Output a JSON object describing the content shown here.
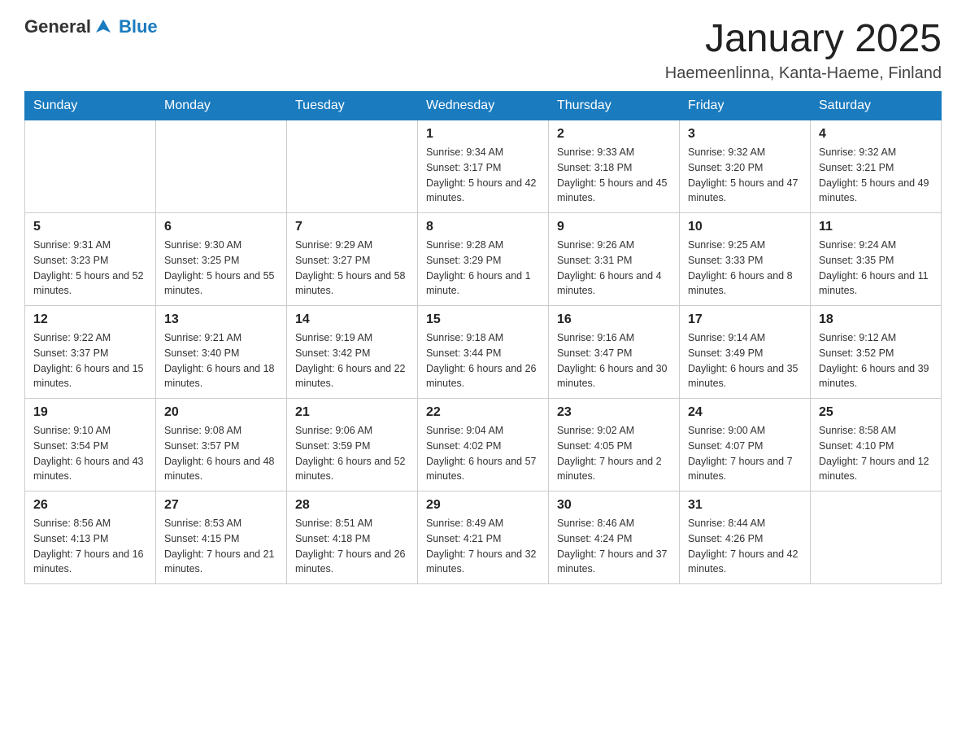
{
  "logo": {
    "text_general": "General",
    "text_blue": "Blue"
  },
  "title": "January 2025",
  "subtitle": "Haemeenlinna, Kanta-Haeme, Finland",
  "days_of_week": [
    "Sunday",
    "Monday",
    "Tuesday",
    "Wednesday",
    "Thursday",
    "Friday",
    "Saturday"
  ],
  "weeks": [
    [
      {
        "day": "",
        "info": ""
      },
      {
        "day": "",
        "info": ""
      },
      {
        "day": "",
        "info": ""
      },
      {
        "day": "1",
        "info": "Sunrise: 9:34 AM\nSunset: 3:17 PM\nDaylight: 5 hours and 42 minutes."
      },
      {
        "day": "2",
        "info": "Sunrise: 9:33 AM\nSunset: 3:18 PM\nDaylight: 5 hours and 45 minutes."
      },
      {
        "day": "3",
        "info": "Sunrise: 9:32 AM\nSunset: 3:20 PM\nDaylight: 5 hours and 47 minutes."
      },
      {
        "day": "4",
        "info": "Sunrise: 9:32 AM\nSunset: 3:21 PM\nDaylight: 5 hours and 49 minutes."
      }
    ],
    [
      {
        "day": "5",
        "info": "Sunrise: 9:31 AM\nSunset: 3:23 PM\nDaylight: 5 hours and 52 minutes."
      },
      {
        "day": "6",
        "info": "Sunrise: 9:30 AM\nSunset: 3:25 PM\nDaylight: 5 hours and 55 minutes."
      },
      {
        "day": "7",
        "info": "Sunrise: 9:29 AM\nSunset: 3:27 PM\nDaylight: 5 hours and 58 minutes."
      },
      {
        "day": "8",
        "info": "Sunrise: 9:28 AM\nSunset: 3:29 PM\nDaylight: 6 hours and 1 minute."
      },
      {
        "day": "9",
        "info": "Sunrise: 9:26 AM\nSunset: 3:31 PM\nDaylight: 6 hours and 4 minutes."
      },
      {
        "day": "10",
        "info": "Sunrise: 9:25 AM\nSunset: 3:33 PM\nDaylight: 6 hours and 8 minutes."
      },
      {
        "day": "11",
        "info": "Sunrise: 9:24 AM\nSunset: 3:35 PM\nDaylight: 6 hours and 11 minutes."
      }
    ],
    [
      {
        "day": "12",
        "info": "Sunrise: 9:22 AM\nSunset: 3:37 PM\nDaylight: 6 hours and 15 minutes."
      },
      {
        "day": "13",
        "info": "Sunrise: 9:21 AM\nSunset: 3:40 PM\nDaylight: 6 hours and 18 minutes."
      },
      {
        "day": "14",
        "info": "Sunrise: 9:19 AM\nSunset: 3:42 PM\nDaylight: 6 hours and 22 minutes."
      },
      {
        "day": "15",
        "info": "Sunrise: 9:18 AM\nSunset: 3:44 PM\nDaylight: 6 hours and 26 minutes."
      },
      {
        "day": "16",
        "info": "Sunrise: 9:16 AM\nSunset: 3:47 PM\nDaylight: 6 hours and 30 minutes."
      },
      {
        "day": "17",
        "info": "Sunrise: 9:14 AM\nSunset: 3:49 PM\nDaylight: 6 hours and 35 minutes."
      },
      {
        "day": "18",
        "info": "Sunrise: 9:12 AM\nSunset: 3:52 PM\nDaylight: 6 hours and 39 minutes."
      }
    ],
    [
      {
        "day": "19",
        "info": "Sunrise: 9:10 AM\nSunset: 3:54 PM\nDaylight: 6 hours and 43 minutes."
      },
      {
        "day": "20",
        "info": "Sunrise: 9:08 AM\nSunset: 3:57 PM\nDaylight: 6 hours and 48 minutes."
      },
      {
        "day": "21",
        "info": "Sunrise: 9:06 AM\nSunset: 3:59 PM\nDaylight: 6 hours and 52 minutes."
      },
      {
        "day": "22",
        "info": "Sunrise: 9:04 AM\nSunset: 4:02 PM\nDaylight: 6 hours and 57 minutes."
      },
      {
        "day": "23",
        "info": "Sunrise: 9:02 AM\nSunset: 4:05 PM\nDaylight: 7 hours and 2 minutes."
      },
      {
        "day": "24",
        "info": "Sunrise: 9:00 AM\nSunset: 4:07 PM\nDaylight: 7 hours and 7 minutes."
      },
      {
        "day": "25",
        "info": "Sunrise: 8:58 AM\nSunset: 4:10 PM\nDaylight: 7 hours and 12 minutes."
      }
    ],
    [
      {
        "day": "26",
        "info": "Sunrise: 8:56 AM\nSunset: 4:13 PM\nDaylight: 7 hours and 16 minutes."
      },
      {
        "day": "27",
        "info": "Sunrise: 8:53 AM\nSunset: 4:15 PM\nDaylight: 7 hours and 21 minutes."
      },
      {
        "day": "28",
        "info": "Sunrise: 8:51 AM\nSunset: 4:18 PM\nDaylight: 7 hours and 26 minutes."
      },
      {
        "day": "29",
        "info": "Sunrise: 8:49 AM\nSunset: 4:21 PM\nDaylight: 7 hours and 32 minutes."
      },
      {
        "day": "30",
        "info": "Sunrise: 8:46 AM\nSunset: 4:24 PM\nDaylight: 7 hours and 37 minutes."
      },
      {
        "day": "31",
        "info": "Sunrise: 8:44 AM\nSunset: 4:26 PM\nDaylight: 7 hours and 42 minutes."
      },
      {
        "day": "",
        "info": ""
      }
    ]
  ]
}
